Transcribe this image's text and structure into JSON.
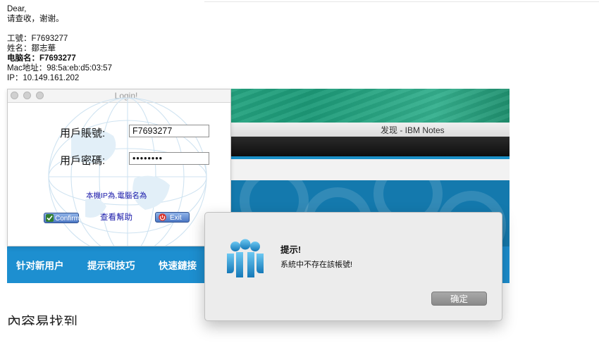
{
  "email": {
    "greeting": "Dear,",
    "line2": "请查收，谢谢。",
    "staff_id_label": "工號：",
    "staff_id": "F7693277",
    "name_label": "姓名：",
    "name": "鄒志華",
    "computer_label": "电脑名：",
    "computer_name": "F7693277",
    "mac_label": "Mac地址：",
    "mac": "98:5a:eb:d5:03:57",
    "ip_label": "IP：",
    "ip": "10.149.161.202"
  },
  "notes_window": {
    "title": "发现 - IBM Notes",
    "nav": [
      "针对新用户",
      "提示和技巧",
      "快速鏈接"
    ],
    "heading": "內容易找到"
  },
  "login_window": {
    "title": "Login!",
    "account_label": "用戶賬號:",
    "account_value": "F7693277",
    "password_label": "用戶密碼:",
    "password_value": "••••••••",
    "info_text": "本機IP為,電腦名為",
    "help_link": "查看幫助",
    "confirm_label": "Confirm",
    "exit_label": "Exit"
  },
  "alert_dialog": {
    "title": "提示!",
    "message": "系統中不存在該帳號!",
    "ok_label": "确定"
  },
  "colors": {
    "notes_blue": "#1479ad",
    "nav_blue": "#1d8fd0",
    "link_blue": "#1a1aaa"
  }
}
